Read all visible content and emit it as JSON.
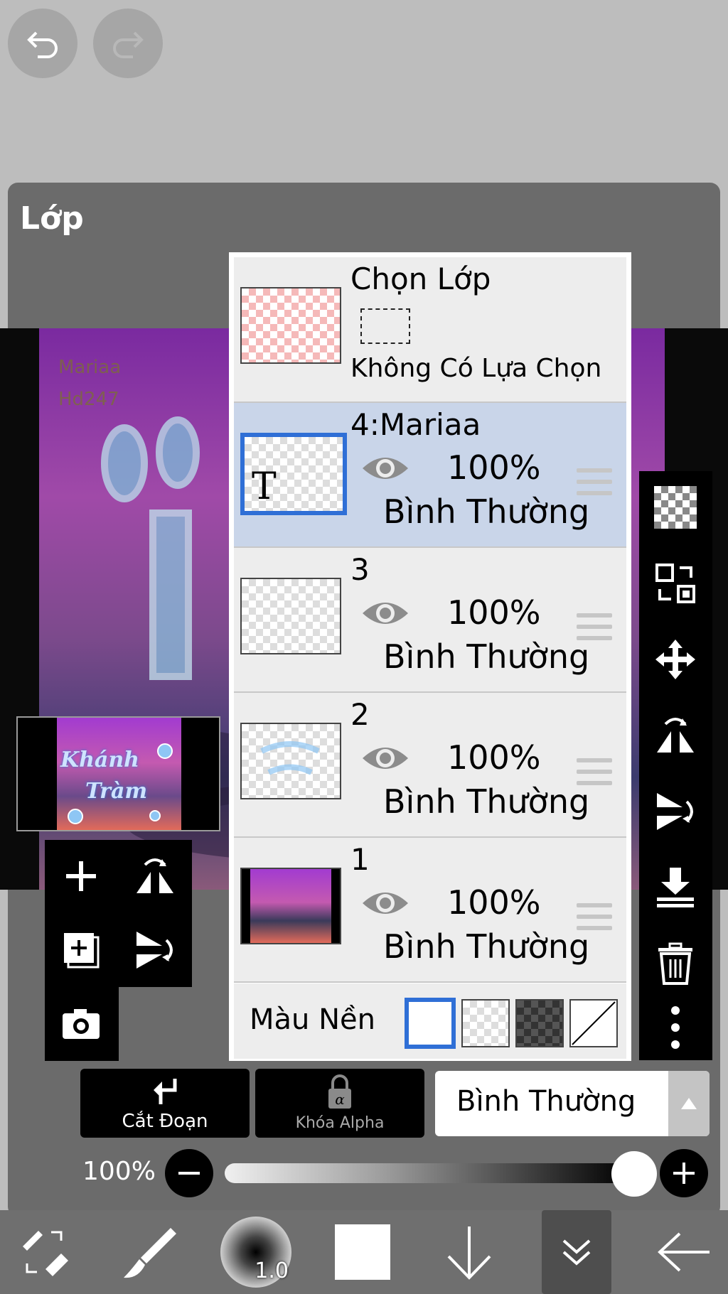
{
  "top_bar": {
    "undo_icon": "undo-icon",
    "redo_icon": "redo-icon"
  },
  "panel": {
    "title": "Lớp"
  },
  "canvas": {
    "sig1": "Mariaa",
    "sig2": "Hd247"
  },
  "selection_layer": {
    "title": "Chọn Lớp",
    "subtitle": "Không Có Lựa Chọn"
  },
  "layers": [
    {
      "name": "4:Mariaa",
      "opacity": "100%",
      "mode": "Bình Thường",
      "active": true,
      "thumb_glyph": "T"
    },
    {
      "name": "3",
      "opacity": "100%",
      "mode": "Bình Thường",
      "active": false
    },
    {
      "name": "2",
      "opacity": "100%",
      "mode": "Bình Thường",
      "active": false
    },
    {
      "name": "1",
      "opacity": "100%",
      "mode": "Bình Thường",
      "active": false
    }
  ],
  "background": {
    "label": "Màu Nền",
    "selected": "white"
  },
  "preview": {
    "line1": "Khánh",
    "line2": "Tràm"
  },
  "actions": {
    "clip_label": "Cắt Đoạn",
    "alpha_lock_label": "Khóa Alpha"
  },
  "blend_mode": {
    "value": "Bình Thường"
  },
  "opacity": {
    "label": "100%",
    "value": 1.0
  },
  "brush": {
    "size_label": "1.0"
  },
  "colors": {
    "active_blue": "#2f6fd6",
    "panel_gray": "#6b6b6b",
    "active_row": "#c9d5e9"
  }
}
